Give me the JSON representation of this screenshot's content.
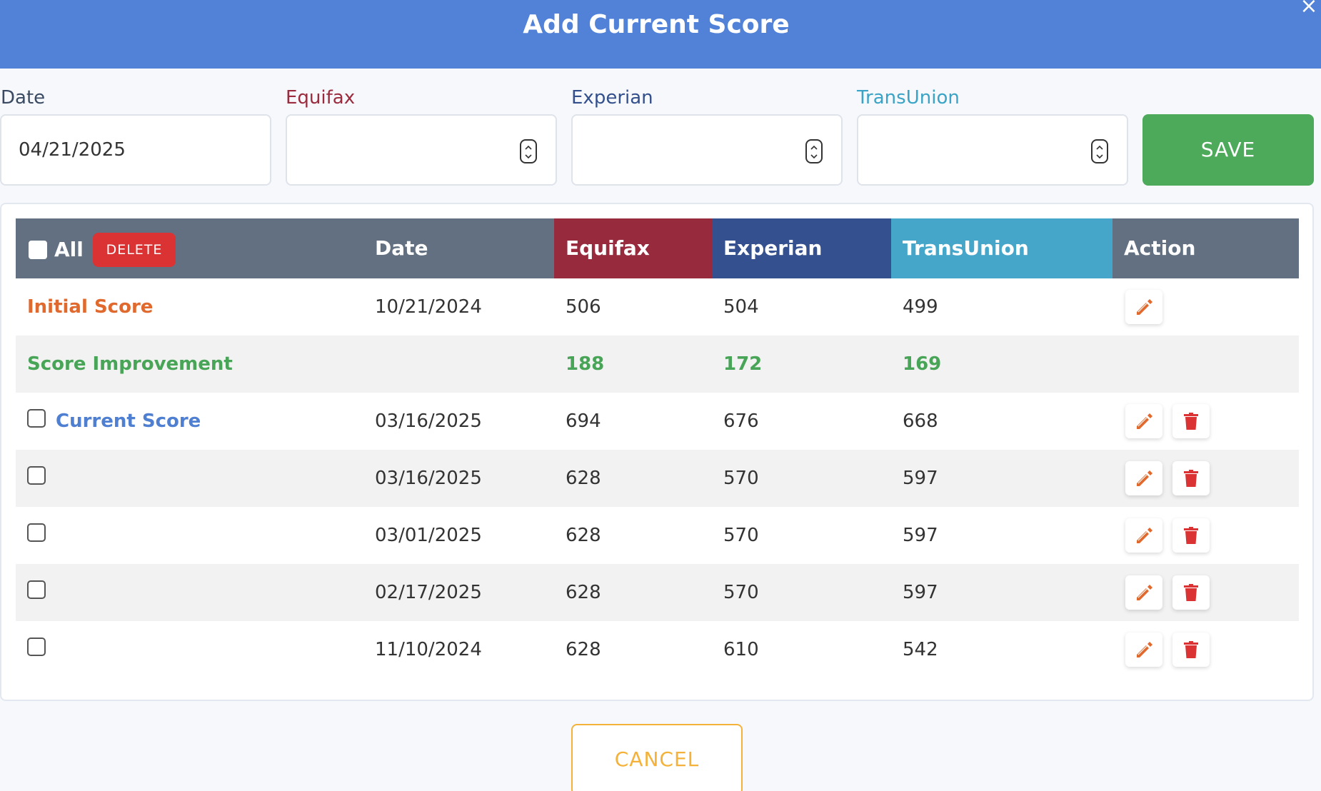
{
  "modal": {
    "title": "Add Current Score",
    "close_glyph": "×"
  },
  "form": {
    "date_label": "Date",
    "date_value": "04/21/2025",
    "equifax_label": "Equifax",
    "experian_label": "Experian",
    "transunion_label": "TransUnion",
    "save_label": "SAVE"
  },
  "table": {
    "all_label": "All",
    "delete_label": "DELETE",
    "headers": {
      "date": "Date",
      "equifax": "Equifax",
      "experian": "Experian",
      "transunion": "TransUnion",
      "action": "Action"
    },
    "initial": {
      "label": "Initial Score",
      "date": "10/21/2024",
      "equifax": "506",
      "experian": "504",
      "transunion": "499"
    },
    "improvement": {
      "label": "Score Improvement",
      "equifax": "188",
      "experian": "172",
      "transunion": "169"
    },
    "rows": [
      {
        "label": "Current Score",
        "date": "03/16/2025",
        "equifax": "694",
        "experian": "676",
        "transunion": "668"
      },
      {
        "label": "",
        "date": "03/16/2025",
        "equifax": "628",
        "experian": "570",
        "transunion": "597"
      },
      {
        "label": "",
        "date": "03/01/2025",
        "equifax": "628",
        "experian": "570",
        "transunion": "597"
      },
      {
        "label": "",
        "date": "02/17/2025",
        "equifax": "628",
        "experian": "570",
        "transunion": "597"
      },
      {
        "label": "",
        "date": "11/10/2024",
        "equifax": "628",
        "experian": "610",
        "transunion": "542"
      }
    ]
  },
  "footer": {
    "cancel_label": "CANCEL"
  },
  "colors": {
    "header_blue": "#5182d8",
    "equifax": "#982a3d",
    "experian": "#34508f",
    "transunion": "#45a6c9",
    "save_green": "#4caa5a",
    "delete_red": "#db3333",
    "edit_orange": "#e0692e",
    "cancel_amber": "#f4b23a"
  },
  "icons": [
    "close-icon",
    "stepper-icon",
    "pencil-icon",
    "trash-icon"
  ]
}
